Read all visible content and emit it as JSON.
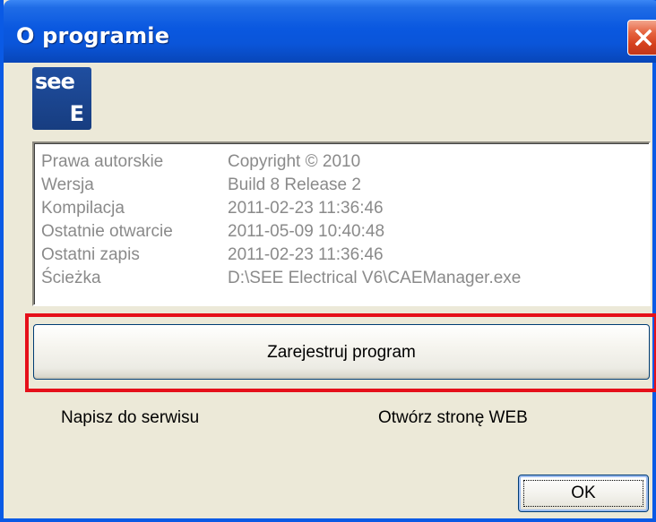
{
  "window": {
    "title": "O programie"
  },
  "logo": {
    "top_text": "see",
    "bottom_text": "E"
  },
  "info": {
    "rows": [
      {
        "label": "Prawa autorskie",
        "value": "Copyright © 2010"
      },
      {
        "label": "Wersja",
        "value": "Build 8 Release 2"
      },
      {
        "label": "Kompilacja",
        "value": "2011-02-23 11:36:46"
      },
      {
        "label": "Ostatnie otwarcie",
        "value": "2011-05-09 10:40:48"
      },
      {
        "label": "Ostatni zapis",
        "value": "2011-02-23 11:36:46"
      },
      {
        "label": "Ścieżka",
        "value": "D:\\SEE Electrical V6\\CAEManager.exe"
      }
    ]
  },
  "buttons": {
    "register_label": "Zarejestruj program",
    "ok_label": "OK"
  },
  "links": {
    "support": "Napisz do serwisu",
    "web": "Otwórz stronę WEB"
  },
  "icons": {
    "close": "close-icon"
  },
  "colors": {
    "titlebar": "#0a58e0",
    "close_button": "#d5401c",
    "highlight": "#e5101a",
    "dialog_bg": "#ece9d8",
    "info_text": "#8a8a8a",
    "logo_bg": "#1f4ea0"
  }
}
